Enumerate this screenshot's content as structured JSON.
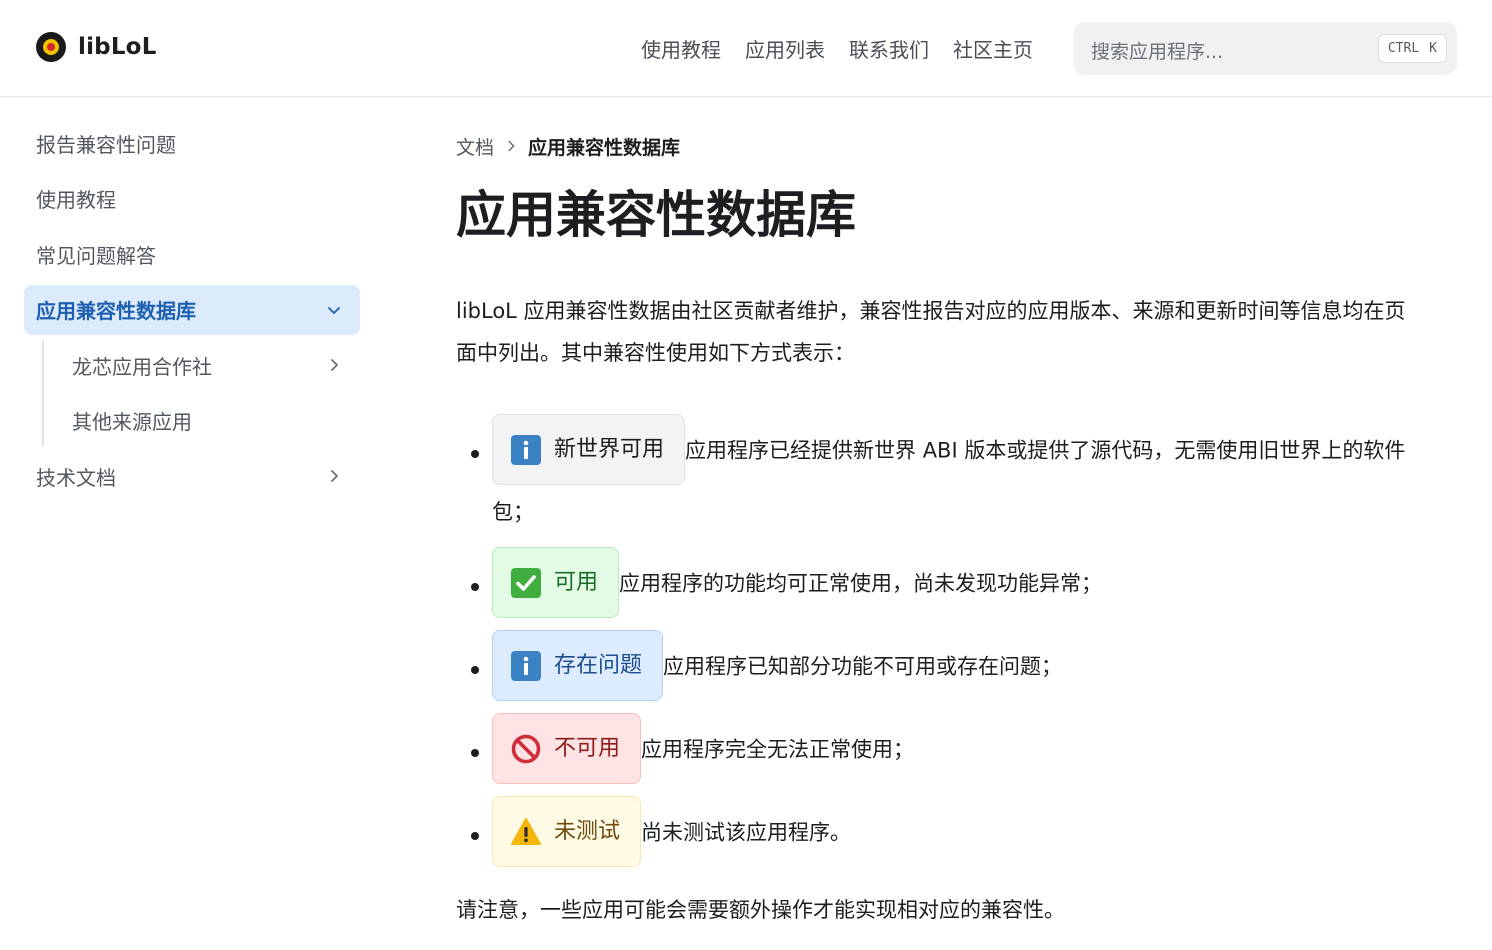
{
  "header": {
    "brand": "libLoL",
    "nav": [
      "使用教程",
      "应用列表",
      "联系我们",
      "社区主页"
    ],
    "search": {
      "placeholder": "搜索应用程序...",
      "shortcut_mod": "CTRL",
      "shortcut_key": "K"
    }
  },
  "sidebar": {
    "items": [
      {
        "label": "报告兼容性问题"
      },
      {
        "label": "使用教程"
      },
      {
        "label": "常见问题解答"
      },
      {
        "label": "应用兼容性数据库",
        "active": true
      },
      {
        "label": "技术文档"
      }
    ],
    "sub_items": [
      {
        "label": "龙芯应用合作社"
      },
      {
        "label": "其他来源应用"
      }
    ]
  },
  "breadcrumb": {
    "root": "文档",
    "current": "应用兼容性数据库"
  },
  "page": {
    "title": "应用兼容性数据库",
    "intro": "libLoL 应用兼容性数据由社区贡献者维护，兼容性报告对应的应用版本、来源和更新时间等信息均在页面中列出。其中兼容性使用如下方式表示：",
    "legend": [
      {
        "badge": "新世界可用",
        "icon": "info-icon",
        "desc": "应用程序已经提供新世界 ABI 版本或提供了源代码，无需使用旧世界上的软件包；"
      },
      {
        "badge": "可用",
        "icon": "check-icon",
        "desc": "应用程序的功能均可正常使用，尚未发现功能异常；"
      },
      {
        "badge": "存在问题",
        "icon": "info-icon",
        "desc": "应用程序已知部分功能不可用或存在问题；"
      },
      {
        "badge": "不可用",
        "icon": "prohibited-icon",
        "desc": "应用程序完全无法正常使用；"
      },
      {
        "badge": "未测试",
        "icon": "warning-icon",
        "desc": "尚未测试该应用程序。"
      }
    ],
    "note": "请注意，一些应用可能会需要额外操作才能实现相对应的兼容性。"
  },
  "colors": {
    "accent": "#1d5fb1",
    "active_bg": "#dcebfb"
  }
}
